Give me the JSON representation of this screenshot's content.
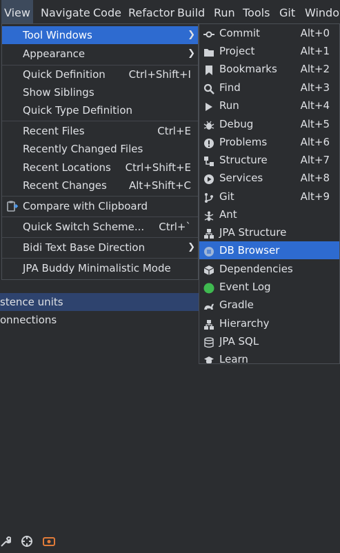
{
  "menubar": [
    {
      "label": "View",
      "active": true
    },
    {
      "label": "Navigate"
    },
    {
      "label": "Code"
    },
    {
      "label": "Refactor"
    },
    {
      "label": "Build"
    },
    {
      "label": "Run"
    },
    {
      "label": "Tools"
    },
    {
      "label": "Git"
    },
    {
      "label": "Window"
    }
  ],
  "view_menu": {
    "tool_windows": "Tool Windows",
    "appearance": "Appearance",
    "quick_definition": {
      "label": "Quick Definition",
      "shortcut": "Ctrl+Shift+I"
    },
    "show_siblings": "Show Siblings",
    "quick_type_definition": "Quick Type Definition",
    "recent_files": {
      "label": "Recent Files",
      "shortcut": "Ctrl+E"
    },
    "recently_changed_files": "Recently Changed Files",
    "recent_locations": {
      "label": "Recent Locations",
      "shortcut": "Ctrl+Shift+E"
    },
    "recent_changes": {
      "label": "Recent Changes",
      "shortcut": "Alt+Shift+C"
    },
    "compare_clipboard": "Compare with Clipboard",
    "quick_switch": {
      "label": "Quick Switch Scheme...",
      "shortcut": "Ctrl+`"
    },
    "bidi": "Bidi Text Base Direction",
    "jpa_buddy": "JPA Buddy Minimalistic Mode"
  },
  "tool_windows_menu": [
    {
      "label": "Commit",
      "shortcut": "Alt+0",
      "icon": "commit-icon"
    },
    {
      "label": "Project",
      "shortcut": "Alt+1",
      "icon": "folder-icon"
    },
    {
      "label": "Bookmarks",
      "shortcut": "Alt+2",
      "icon": "bookmark-icon"
    },
    {
      "label": "Find",
      "shortcut": "Alt+3",
      "icon": "search-icon"
    },
    {
      "label": "Run",
      "shortcut": "Alt+4",
      "icon": "play-icon"
    },
    {
      "label": "Debug",
      "shortcut": "Alt+5",
      "icon": "bug-icon"
    },
    {
      "label": "Problems",
      "shortcut": "Alt+6",
      "icon": "problems-icon"
    },
    {
      "label": "Structure",
      "shortcut": "Alt+7",
      "icon": "structure-icon"
    },
    {
      "label": "Services",
      "shortcut": "Alt+8",
      "icon": "services-icon"
    },
    {
      "label": "Git",
      "shortcut": "Alt+9",
      "icon": "git-icon"
    },
    {
      "label": "Ant",
      "shortcut": "",
      "icon": "ant-icon"
    },
    {
      "label": "JPA Structure",
      "shortcut": "",
      "icon": "jpa-structure-icon"
    },
    {
      "label": "DB Browser",
      "shortcut": "",
      "icon": "db-browser-icon",
      "highlighted": true
    },
    {
      "label": "Dependencies",
      "shortcut": "",
      "icon": "dependencies-icon"
    },
    {
      "label": "Event Log",
      "shortcut": "",
      "icon": "event-log-icon"
    },
    {
      "label": "Gradle",
      "shortcut": "",
      "icon": "gradle-icon"
    },
    {
      "label": "Hierarchy",
      "shortcut": "",
      "icon": "hierarchy-icon"
    },
    {
      "label": "JPA SQL",
      "shortcut": "",
      "icon": "database-icon"
    },
    {
      "label": "Learn",
      "shortcut": "",
      "icon": "learn-icon"
    }
  ],
  "background": {
    "row1": "stence units",
    "row2": "onnections"
  },
  "colors": {
    "highlight": "#2e6bd0",
    "background": "#2b2d30",
    "text": "#dfe1e5"
  }
}
